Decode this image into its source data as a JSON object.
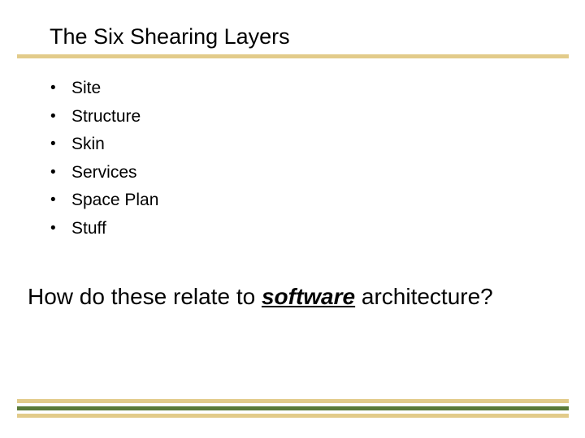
{
  "slide": {
    "title": "The Six Shearing Layers",
    "bullets": [
      {
        "marker": "•",
        "text": "Site"
      },
      {
        "marker": "•",
        "text": "Structure"
      },
      {
        "marker": "•",
        "text": "Skin"
      },
      {
        "marker": "•",
        "text": "Services"
      },
      {
        "marker": "•",
        "text": "Space Plan"
      },
      {
        "marker": "•",
        "text": "Stuff"
      }
    ],
    "question": {
      "before": "How do these relate to ",
      "emphasis": "software",
      "after": " architecture?"
    },
    "colors": {
      "tan_rule": "#e2cb8a",
      "green_rule": "#5a7a38"
    }
  }
}
